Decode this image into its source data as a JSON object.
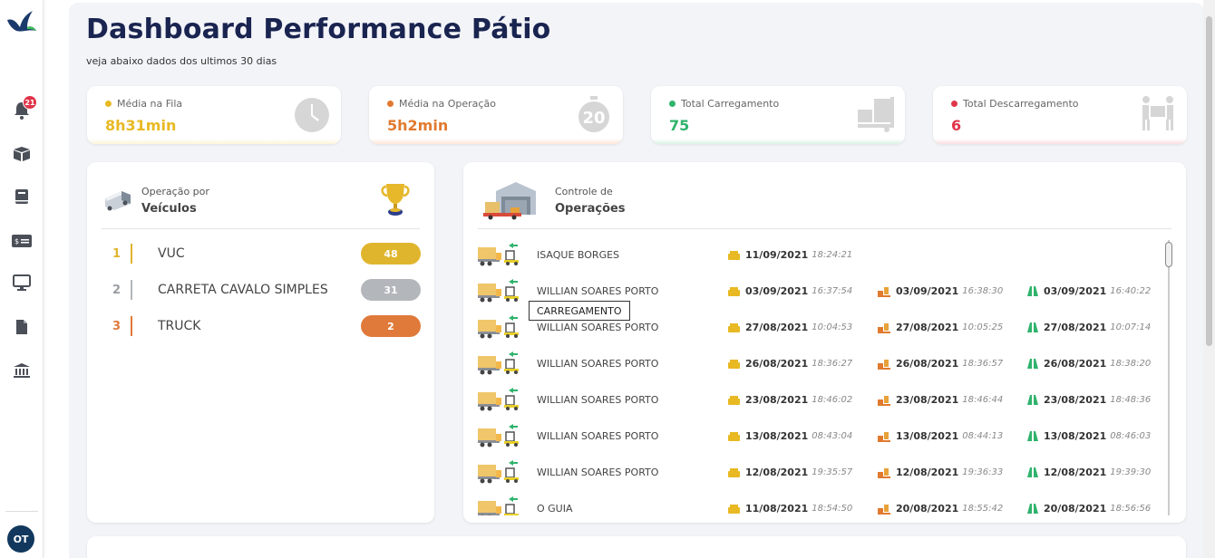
{
  "page": {
    "title": "Dashboard Performance Pátio",
    "subtitle": "veja abaixo dados dos ultimos 30 dias"
  },
  "sidebar": {
    "notifications_count": "21",
    "items": [
      {
        "icon": "bell-icon"
      },
      {
        "icon": "box-icon"
      },
      {
        "icon": "book-icon"
      },
      {
        "icon": "money-icon"
      },
      {
        "icon": "monitor-icon"
      },
      {
        "icon": "file-icon"
      },
      {
        "icon": "bank-icon"
      }
    ],
    "avatar_initials": "OT"
  },
  "kpis": [
    {
      "label": "Média na Fila",
      "value": "8h31min",
      "color": "#e8b923",
      "icon": "clock-icon"
    },
    {
      "label": "Média na Operação",
      "value": "5h2min",
      "color": "#e07a2e",
      "icon": "stopwatch-icon"
    },
    {
      "label": "Total Carregamento",
      "value": "75",
      "color": "#2fb36c",
      "icon": "hand-truck-icon"
    },
    {
      "label": "Total Descarregamento",
      "value": "6",
      "color": "#e0344a",
      "icon": "people-carry-icon"
    }
  ],
  "vehicles_panel": {
    "title_small": "Operação por",
    "title_big": "Veículos",
    "rows": [
      {
        "rank": "1",
        "name": "VUC",
        "count": "48",
        "color": "#e0b52e"
      },
      {
        "rank": "2",
        "name": "CARRETA CAVALO SIMPLES",
        "count": "31",
        "color": "#b3b7bb"
      },
      {
        "rank": "3",
        "name": "TRUCK",
        "count": "2",
        "color": "#df7a3a"
      }
    ]
  },
  "operations_panel": {
    "title_small": "Controle de",
    "title_big": "Operações",
    "tooltip": "CARREGAMENTO",
    "rows": [
      {
        "name": "ISAQUE BORGES",
        "d1": "11/09/2021",
        "t1": "18:24:21",
        "d2": "",
        "t2": "",
        "d3": "",
        "t3": ""
      },
      {
        "name": "WILLIAN SOARES PORTO",
        "d1": "03/09/2021",
        "t1": "16:37:54",
        "d2": "03/09/2021",
        "t2": "16:38:30",
        "d3": "03/09/2021",
        "t3": "16:40:22"
      },
      {
        "name": "WILLIAN SOARES PORTO",
        "d1": "27/08/2021",
        "t1": "10:04:53",
        "d2": "27/08/2021",
        "t2": "10:05:25",
        "d3": "27/08/2021",
        "t3": "10:07:14"
      },
      {
        "name": "WILLIAN SOARES PORTO",
        "d1": "26/08/2021",
        "t1": "18:36:27",
        "d2": "26/08/2021",
        "t2": "18:36:57",
        "d3": "26/08/2021",
        "t3": "18:38:20"
      },
      {
        "name": "WILLIAN SOARES PORTO",
        "d1": "23/08/2021",
        "t1": "18:46:02",
        "d2": "23/08/2021",
        "t2": "18:46:44",
        "d3": "23/08/2021",
        "t3": "18:48:36"
      },
      {
        "name": "WILLIAN SOARES PORTO",
        "d1": "13/08/2021",
        "t1": "08:43:04",
        "d2": "13/08/2021",
        "t2": "08:44:13",
        "d3": "13/08/2021",
        "t3": "08:46:03"
      },
      {
        "name": "WILLIAN SOARES PORTO",
        "d1": "12/08/2021",
        "t1": "19:35:57",
        "d2": "12/08/2021",
        "t2": "19:36:33",
        "d3": "12/08/2021",
        "t3": "19:39:30"
      },
      {
        "name": "O GUIA",
        "d1": "11/08/2021",
        "t1": "18:54:50",
        "d2": "20/08/2021",
        "t2": "18:55:42",
        "d3": "20/08/2021",
        "t3": "18:56:56"
      }
    ]
  }
}
